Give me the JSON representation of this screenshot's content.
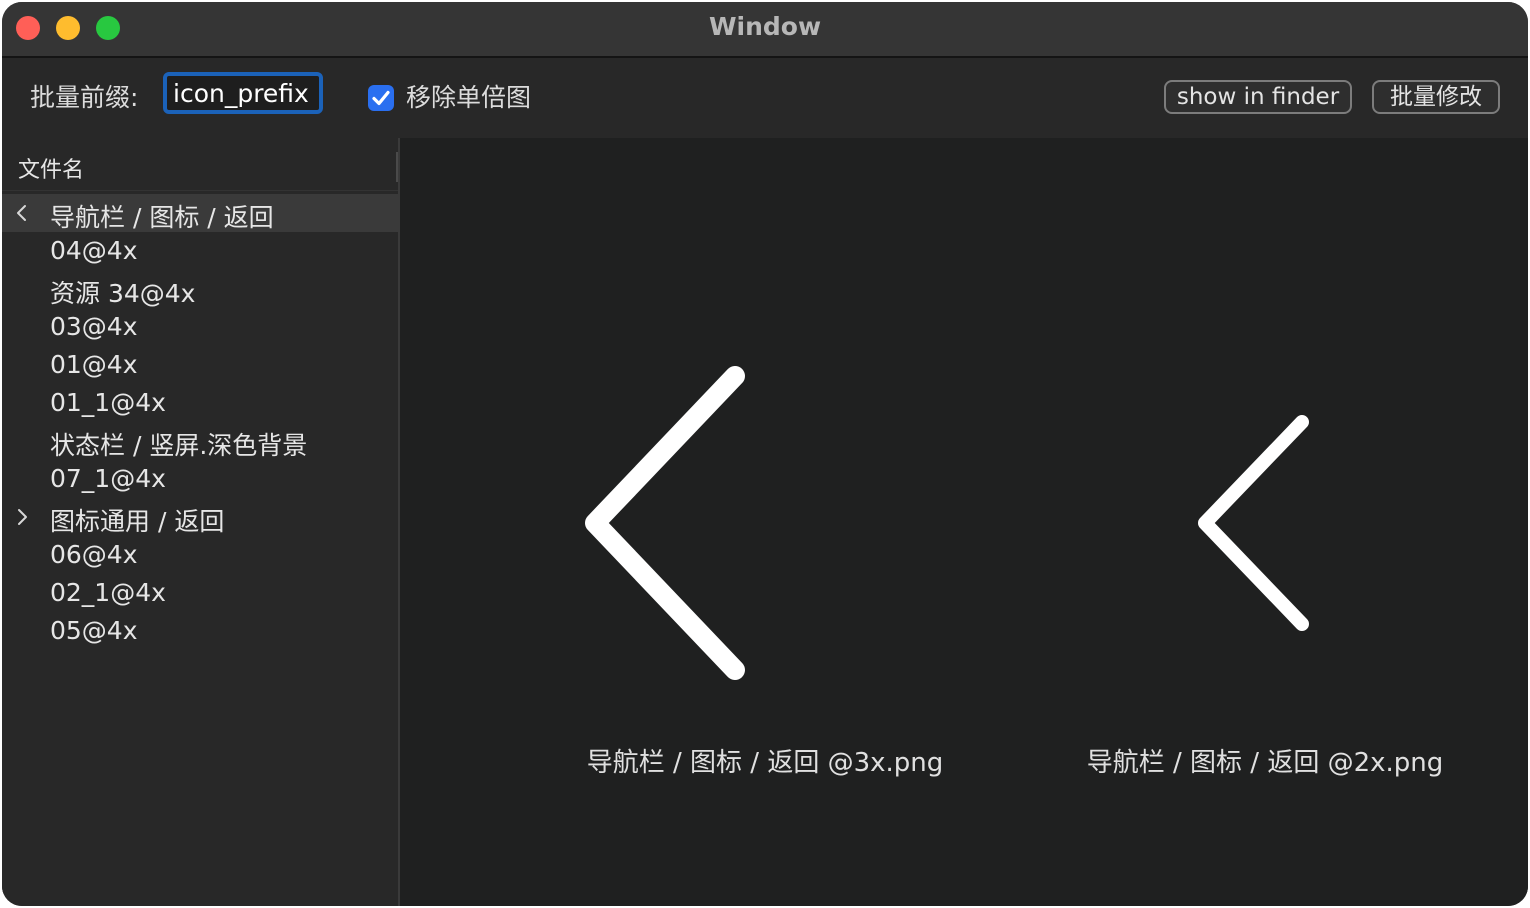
{
  "window": {
    "title": "Window"
  },
  "toolbar": {
    "prefix_label": "批量前缀:",
    "prefix_value": "icon_prefix",
    "remove_single_label": "移除单倍图",
    "remove_single_checked": true,
    "show_in_finder_label": "show in finder",
    "batch_modify_label": "批量修改"
  },
  "file_list": {
    "column_header": "文件名",
    "items": [
      {
        "label": "导航栏 / 图标 / 返回",
        "disclosure": "expanded",
        "selected": true
      },
      {
        "label": "04@4x"
      },
      {
        "label": "资源 34@4x"
      },
      {
        "label": "03@4x"
      },
      {
        "label": "01@4x"
      },
      {
        "label": "01_1@4x"
      },
      {
        "label": "状态栏 / 竖屏.深色背景"
      },
      {
        "label": "07_1@4x"
      },
      {
        "label": "图标通用 / 返回",
        "disclosure": "collapsed"
      },
      {
        "label": "06@4x"
      },
      {
        "label": "02_1@4x"
      },
      {
        "label": "05@4x"
      }
    ]
  },
  "preview": {
    "items": [
      {
        "caption": "导航栏 / 图标 / 返回 @3x.png",
        "icon": "chevron-left-icon"
      },
      {
        "caption": "导航栏 / 图标 / 返回 @2x.png",
        "icon": "chevron-left-icon"
      }
    ]
  },
  "colors": {
    "accent": "#1b62b9",
    "checkbox": "#2a6ff0",
    "close": "#ff5f57",
    "minimize": "#febc2e",
    "zoom": "#28c840"
  }
}
